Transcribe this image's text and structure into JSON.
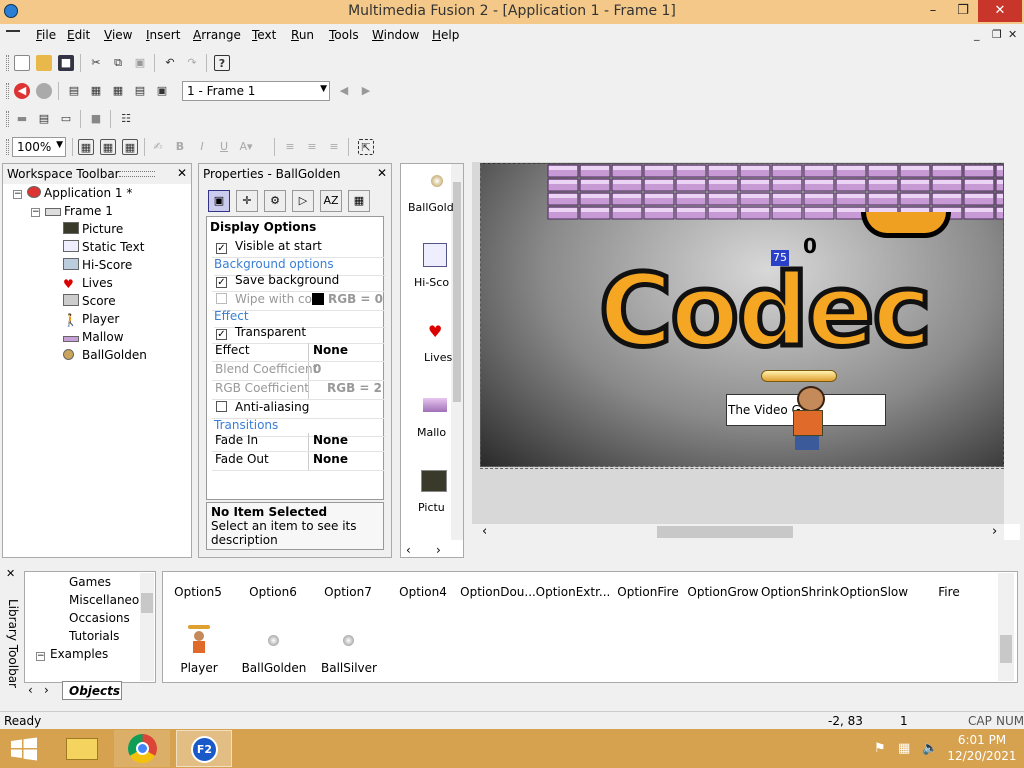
{
  "window": {
    "title": "Multimedia Fusion 2 - [Application 1 - Frame 1]",
    "minimize_icon": "minimize-icon",
    "restore_icon": "restore-icon",
    "close_icon": "close-icon"
  },
  "menu": [
    "File",
    "Edit",
    "View",
    "Insert",
    "Arrange",
    "Text",
    "Run",
    "Tools",
    "Window",
    "Help"
  ],
  "toolbar": {
    "frame_select": "1 - Frame 1",
    "zoom": "100%"
  },
  "workspace": {
    "title": "Workspace Toolbar",
    "application": "Application 1 *",
    "frame": "Frame 1",
    "objects": [
      "Picture",
      "Static Text",
      "Hi-Score",
      "Lives",
      "Score",
      "Player",
      "Mallow",
      "BallGolden"
    ]
  },
  "properties": {
    "title": "Properties - BallGolden",
    "section_display": "Display Options",
    "visible_at_start": "Visible at start",
    "section_background": "Background options",
    "save_background": "Save background",
    "wipe_with_color": "Wipe with co",
    "rgb_zero": "RGB = 0",
    "section_effect": "Effect",
    "transparent": "Transparent",
    "effect_label": "Effect",
    "effect_value": "None",
    "blend_label": "Blend Coefficient",
    "blend_value": "0",
    "rgbcoef_label": "RGB Coefficient",
    "rgbcoef_value": "RGB = 2",
    "antialias": "Anti-aliasing",
    "section_transitions": "Transitions",
    "fade_in_label": "Fade In",
    "fade_in_value": "None",
    "fade_out_label": "Fade Out",
    "fade_out_value": "None",
    "desc_title": "No Item Selected",
    "desc_text": "Select an item to see its description"
  },
  "object_list": [
    "BallGold",
    "Hi-Sco",
    "Lives",
    "Mallo",
    "Pictu"
  ],
  "scene": {
    "hiscore": "75",
    "score": "0",
    "logo": "Codec",
    "static_text": "The Video G"
  },
  "library": {
    "title": "Library Toolbar",
    "tree": [
      "Games",
      "Miscellaneou",
      "Occasions",
      "Tutorials",
      "Examples"
    ],
    "tab": "Objects",
    "row1": [
      "Option5",
      "Option6",
      "Option7",
      "Option4",
      "OptionDou...",
      "OptionExtr...",
      "OptionFire",
      "OptionGrow",
      "OptionShrink",
      "OptionSlow",
      "Fire"
    ],
    "row2": [
      "Player",
      "BallGolden",
      "BallSilver"
    ]
  },
  "status": {
    "ready": "Ready",
    "coords": "-2, 83",
    "frame": "1",
    "cap": "CAP",
    "num": "NUM"
  },
  "taskbar": {
    "time": "6:01 PM",
    "date": "12/20/2021",
    "f2": "F2"
  }
}
